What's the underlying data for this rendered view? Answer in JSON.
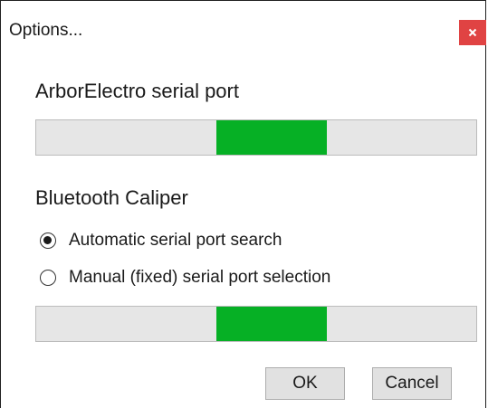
{
  "window": {
    "title": "Options...",
    "close_glyph": "×",
    "close_color": "#e04343"
  },
  "arbor": {
    "label": "ArborElectro serial port",
    "progress": {
      "style": "marquee",
      "fill_color": "#06b025",
      "chunk_start_fraction": 0.41,
      "chunk_end_fraction": 0.66
    }
  },
  "caliper": {
    "label": "Bluetooth Caliper",
    "options": [
      {
        "label": "Automatic serial port search",
        "selected": true
      },
      {
        "label": "Manual (fixed) serial port selection",
        "selected": false
      }
    ],
    "progress": {
      "style": "marquee",
      "fill_color": "#06b025",
      "chunk_start_fraction": 0.41,
      "chunk_end_fraction": 0.66
    }
  },
  "buttons": {
    "ok": "OK",
    "cancel": "Cancel"
  }
}
